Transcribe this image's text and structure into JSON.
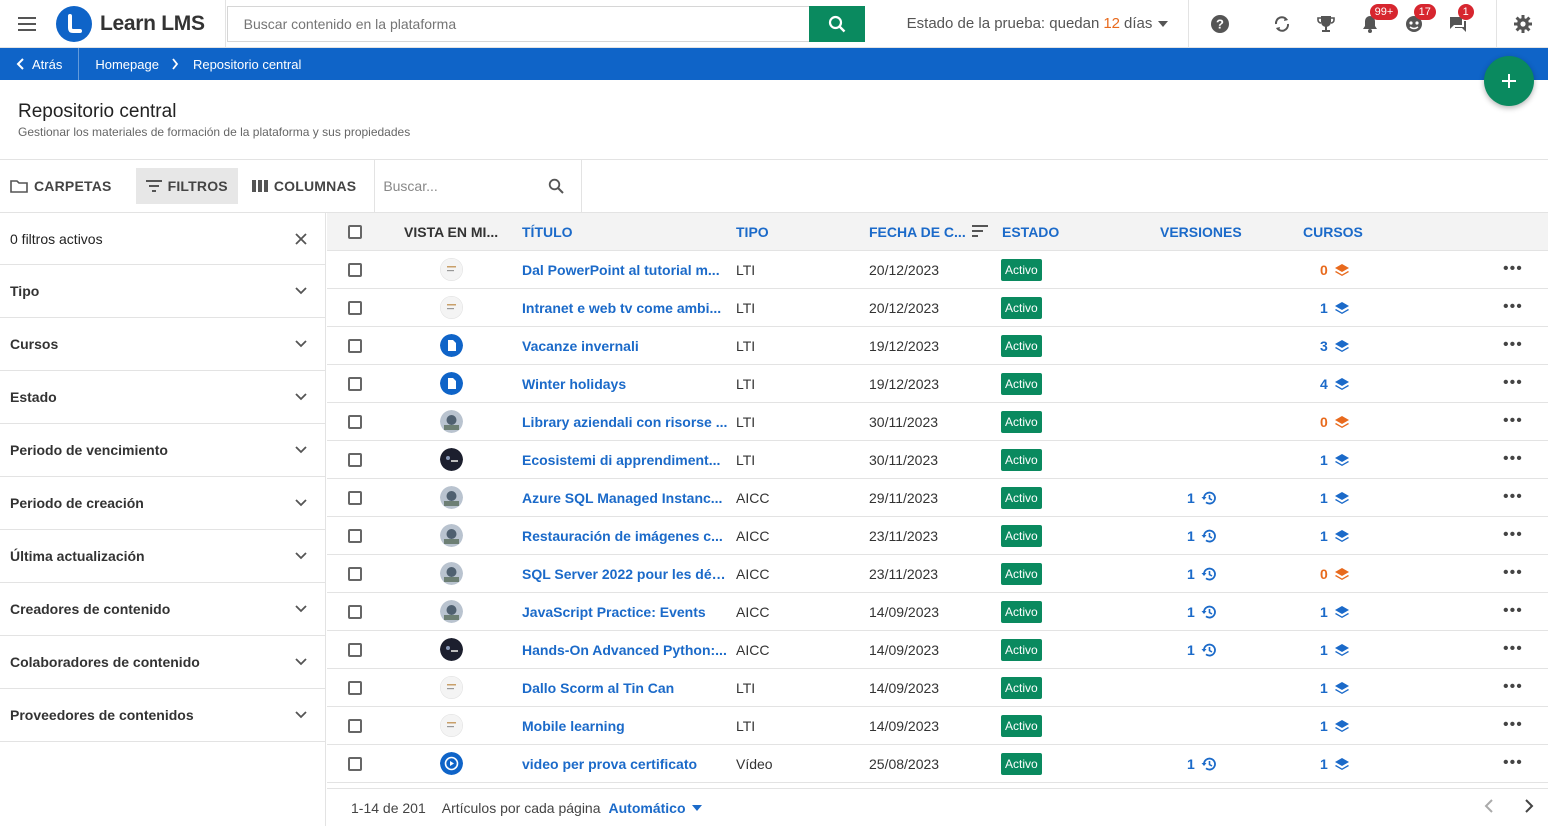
{
  "app": {
    "name": "Learn LMS"
  },
  "colors": {
    "primary": "#0f64c8",
    "accent_green": "#0a8a5f",
    "orange": "#e86a1d",
    "badge_red": "#d7262f",
    "link": "#1b6ac9"
  },
  "topbar": {
    "search_placeholder": "Buscar contenido en la plataforma",
    "trial_prefix": "Estado de la prueba: quedan",
    "trial_days": "12",
    "trial_suffix": "días",
    "badges": {
      "notifications": "99+",
      "users": "17",
      "messages": "1"
    },
    "icons": [
      "menu-icon",
      "help-icon",
      "sync-icon",
      "trophy-icon",
      "bell-icon",
      "user-icon",
      "chat-icon",
      "gear-icon"
    ]
  },
  "breadcrumb": {
    "back": "Atrás",
    "items": [
      "Homepage",
      "Repositorio central"
    ]
  },
  "page": {
    "title": "Repositorio central",
    "subtitle": "Gestionar los materiales de formación de la plataforma y sus propiedades"
  },
  "toolbar": {
    "folders": "CARPETAS",
    "filters": "FILTROS",
    "columns": "COLUMNAS",
    "search_placeholder": "Buscar..."
  },
  "filters": {
    "active": "0 filtros activos",
    "items": [
      "Tipo",
      "Cursos",
      "Estado",
      "Periodo de vencimiento",
      "Periodo de creación",
      "Última actualización",
      "Creadores de contenido",
      "Colaboradores de contenido",
      "Proveedores de contenidos"
    ]
  },
  "table": {
    "headers": {
      "preview": "VISTA EN MI...",
      "title": "TÍTULO",
      "type": "TIPO",
      "date": "FECHA DE C...",
      "status": "ESTADO",
      "versions": "VERSIONES",
      "courses": "CURSOS"
    },
    "rows": [
      {
        "title": "Dal PowerPoint al tutorial m...",
        "type": "LTI",
        "date": "20/12/2023",
        "status": "Activo",
        "versions": "",
        "courses": "0",
        "thumb": "doc"
      },
      {
        "title": "Intranet e web tv come ambi...",
        "type": "LTI",
        "date": "20/12/2023",
        "status": "Activo",
        "versions": "",
        "courses": "1",
        "thumb": "doc"
      },
      {
        "title": "Vacanze invernali",
        "type": "LTI",
        "date": "19/12/2023",
        "status": "Activo",
        "versions": "",
        "courses": "3",
        "thumb": "file"
      },
      {
        "title": "Winter holidays",
        "type": "LTI",
        "date": "19/12/2023",
        "status": "Activo",
        "versions": "",
        "courses": "4",
        "thumb": "file"
      },
      {
        "title": "Library aziendali con risorse ...",
        "type": "LTI",
        "date": "30/11/2023",
        "status": "Activo",
        "versions": "",
        "courses": "0",
        "thumb": "photo"
      },
      {
        "title": "Ecosistemi di apprendiment...",
        "type": "LTI",
        "date": "30/11/2023",
        "status": "Activo",
        "versions": "",
        "courses": "1",
        "thumb": "dark"
      },
      {
        "title": "Azure SQL Managed Instanc...",
        "type": "AICC",
        "date": "29/11/2023",
        "status": "Activo",
        "versions": "1",
        "courses": "1",
        "thumb": "photo"
      },
      {
        "title": "Restauración de imágenes c...",
        "type": "AICC",
        "date": "23/11/2023",
        "status": "Activo",
        "versions": "1",
        "courses": "1",
        "thumb": "photo"
      },
      {
        "title": "SQL Server 2022 pour les dév...",
        "type": "AICC",
        "date": "23/11/2023",
        "status": "Activo",
        "versions": "1",
        "courses": "0",
        "thumb": "photo"
      },
      {
        "title": "JavaScript Practice: Events",
        "type": "AICC",
        "date": "14/09/2023",
        "status": "Activo",
        "versions": "1",
        "courses": "1",
        "thumb": "photo"
      },
      {
        "title": "Hands-On Advanced Python:...",
        "type": "AICC",
        "date": "14/09/2023",
        "status": "Activo",
        "versions": "1",
        "courses": "1",
        "thumb": "dark"
      },
      {
        "title": "Dallo Scorm al Tin Can",
        "type": "LTI",
        "date": "14/09/2023",
        "status": "Activo",
        "versions": "",
        "courses": "1",
        "thumb": "doc"
      },
      {
        "title": "Mobile learning",
        "type": "LTI",
        "date": "14/09/2023",
        "status": "Activo",
        "versions": "",
        "courses": "1",
        "thumb": "doc"
      },
      {
        "title": "video per prova certificato",
        "type": "Vídeo",
        "date": "25/08/2023",
        "status": "Activo",
        "versions": "1",
        "courses": "1",
        "thumb": "video"
      }
    ]
  },
  "footer": {
    "range": "1-14 de 201",
    "per_page_label": "Artículos por cada página",
    "per_page_value": "Automático"
  }
}
